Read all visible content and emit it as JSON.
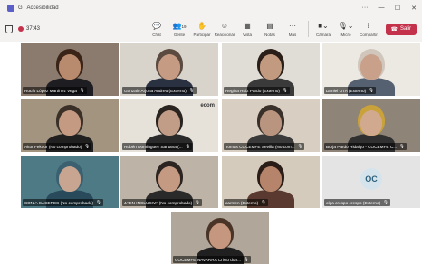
{
  "window": {
    "title": "GT Accesibilidad"
  },
  "toolbar": {
    "timer": "37:43",
    "buttons": [
      {
        "label": "Chat",
        "icon": "chat-icon"
      },
      {
        "label": "Gente",
        "icon": "people-icon",
        "badge": "19"
      },
      {
        "label": "Participar",
        "icon": "raise-hand-icon"
      },
      {
        "label": "Reaccionar",
        "icon": "react-icon"
      },
      {
        "label": "Vista",
        "icon": "view-icon"
      },
      {
        "label": "Notas",
        "icon": "notes-icon"
      },
      {
        "label": "Más",
        "icon": "more-icon"
      }
    ],
    "camera_label": "Cámara",
    "mic_label": "Micro",
    "share_label": "Compartir",
    "leave_label": "Salir"
  },
  "participants": [
    {
      "name": "Rocío López Martínez Vega",
      "skin": "#b88a6e",
      "hair": "#3a2418",
      "shirt": "#1e1e22",
      "bg": "#8a7b6e"
    },
    {
      "name": "Gonzalo Arjona Andreu (Externo)",
      "skin": "#c69b84",
      "hair": "#5a4a40",
      "shirt": "#2a3140",
      "bg": "#d8d4cc",
      "active": true
    },
    {
      "name": "Regina Ruiz Pardo (Externo)",
      "skin": "#c19a80",
      "hair": "#2a1e18",
      "shirt": "#3a3a3a",
      "bg": "#e0ddd6"
    },
    {
      "name": "Daniel OTA (Externo)",
      "skin": "#c9a08a",
      "hair": "#d0c6bc",
      "shirt": "#556070",
      "bg": "#ece8e2"
    },
    {
      "name": "Aitor Fekoor (No comprobado)",
      "skin": "#c49a82",
      "hair": "#3a3028",
      "shirt": "#202020",
      "bg": "#a39480"
    },
    {
      "name": "Rubén Domínguez Santana (...",
      "skin": "#c19c86",
      "hair": "#2a2420",
      "shirt": "#2a2a2a",
      "bg": "#e6e2da",
      "logo": "ecom"
    },
    {
      "name": "Tomás COCEMFE Sevilla (No com...",
      "skin": "#b99580",
      "hair": "#3a302a",
      "shirt": "#3a3a3a",
      "bg": "#d8cfc2"
    },
    {
      "name": "Borja Pardo Hidalgo - COCEMFE C...",
      "skin": "#d1a98e",
      "hair": "#c9a23a",
      "shirt": "#303030",
      "bg": "#8f8478"
    },
    {
      "name": "SONIA CACERES (No comprobado)",
      "skin": "#c8a591",
      "hair": "#3b6070",
      "shirt": "#284a5a",
      "bg": "#4e7a86"
    },
    {
      "name": "JAEN INCLUSIVA (No comprobado)",
      "skin": "#c59a82",
      "hair": "#2c2420",
      "shirt": "#2a2a2a",
      "bg": "#bdb3a6"
    },
    {
      "name": "carmen (Externo)",
      "skin": "#b5846a",
      "hair": "#2a1c16",
      "shirt": "#5a3a30",
      "bg": "#d5cbbd"
    },
    {
      "name": "olga crespo crespo (Externo)",
      "initials": "OC",
      "bg": "#e4e4e4"
    },
    {
      "name": "COCEMFE NAVARRA Cristo don...",
      "skin": "#c5977e",
      "hair": "#4a3428",
      "shirt": "#202020",
      "bg": "#b0a69a"
    }
  ]
}
